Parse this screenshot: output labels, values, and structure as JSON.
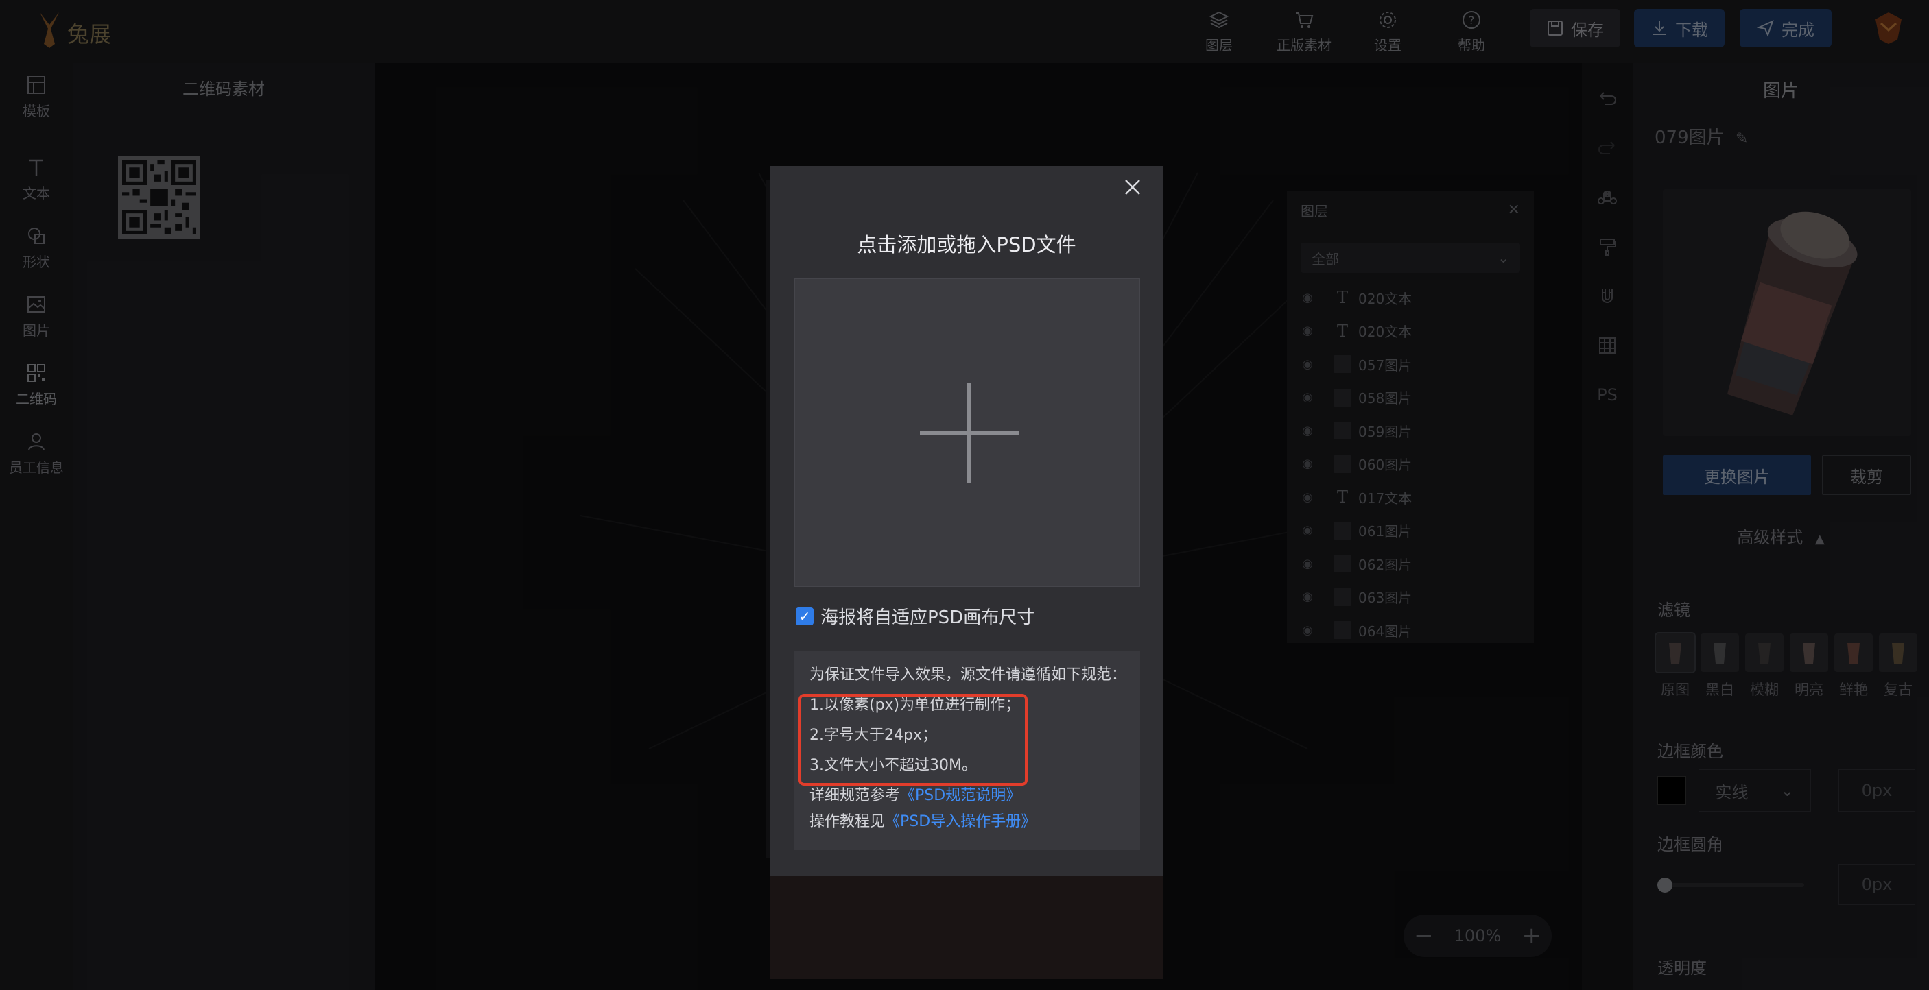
{
  "app": {
    "logo_text": "兔展"
  },
  "topbar": {
    "tools": [
      {
        "icon": "layers-icon",
        "label": "图层"
      },
      {
        "icon": "cart-icon",
        "label": "正版素材"
      },
      {
        "icon": "gear-icon",
        "label": "设置"
      },
      {
        "icon": "help-icon",
        "label": "帮助"
      }
    ],
    "save_label": "保存",
    "download_label": "下载",
    "done_label": "完成"
  },
  "leftnav": {
    "items": [
      {
        "icon": "template-icon",
        "label": "模板"
      },
      {
        "icon": "text-icon",
        "label": "文本"
      },
      {
        "icon": "shape-icon",
        "label": "形状"
      },
      {
        "icon": "image-icon",
        "label": "图片"
      },
      {
        "icon": "qrcode-icon",
        "label": "二维码"
      },
      {
        "icon": "user-icon",
        "label": "员工信息"
      }
    ]
  },
  "leftpanel": {
    "title": "二维码素材"
  },
  "layers": {
    "title": "图层",
    "filter": "全部",
    "items": [
      {
        "type": "text",
        "name": "020文本"
      },
      {
        "type": "text",
        "name": "020文本"
      },
      {
        "type": "image",
        "name": "057图片"
      },
      {
        "type": "image",
        "name": "058图片"
      },
      {
        "type": "image",
        "name": "059图片"
      },
      {
        "type": "image",
        "name": "060图片"
      },
      {
        "type": "text",
        "name": "017文本"
      },
      {
        "type": "image",
        "name": "061图片"
      },
      {
        "type": "image",
        "name": "062图片"
      },
      {
        "type": "image",
        "name": "063图片"
      },
      {
        "type": "image",
        "name": "064图片"
      }
    ]
  },
  "zoom": {
    "minus": "−",
    "value": "100%",
    "plus": "+"
  },
  "rtools": {
    "ps_label": "PS"
  },
  "rpanel": {
    "title": "图片",
    "name": "079图片",
    "replace_label": "更换图片",
    "crop_label": "裁剪",
    "advanced_label": "高级样式",
    "filter_label": "滤镜",
    "filters": [
      "原图",
      "黑白",
      "模糊",
      "明亮",
      "鲜艳",
      "复古"
    ],
    "border_color_label": "边框颜色",
    "border_style": "实线",
    "border_width": "0px",
    "border_radius_label": "边框圆角",
    "border_radius_value": "0px",
    "opacity_label": "透明度"
  },
  "modal": {
    "title": "点击添加或拖入PSD文件",
    "checkbox_label": "海报将自适应PSD画布尺寸",
    "checkbox_checked": true,
    "spec_intro": "为保证文件导入效果，源文件请遵循如下规范：",
    "spec_items": [
      "1.以像素(px)为单位进行制作；",
      "2.字号大于24px；",
      "3.文件大小不超过30M。"
    ],
    "ref_prefix": "详细规范参考",
    "ref_link": "《PSD规范说明》",
    "tutorial_prefix": "操作教程见",
    "tutorial_link": "《PSD导入操作手册》"
  }
}
